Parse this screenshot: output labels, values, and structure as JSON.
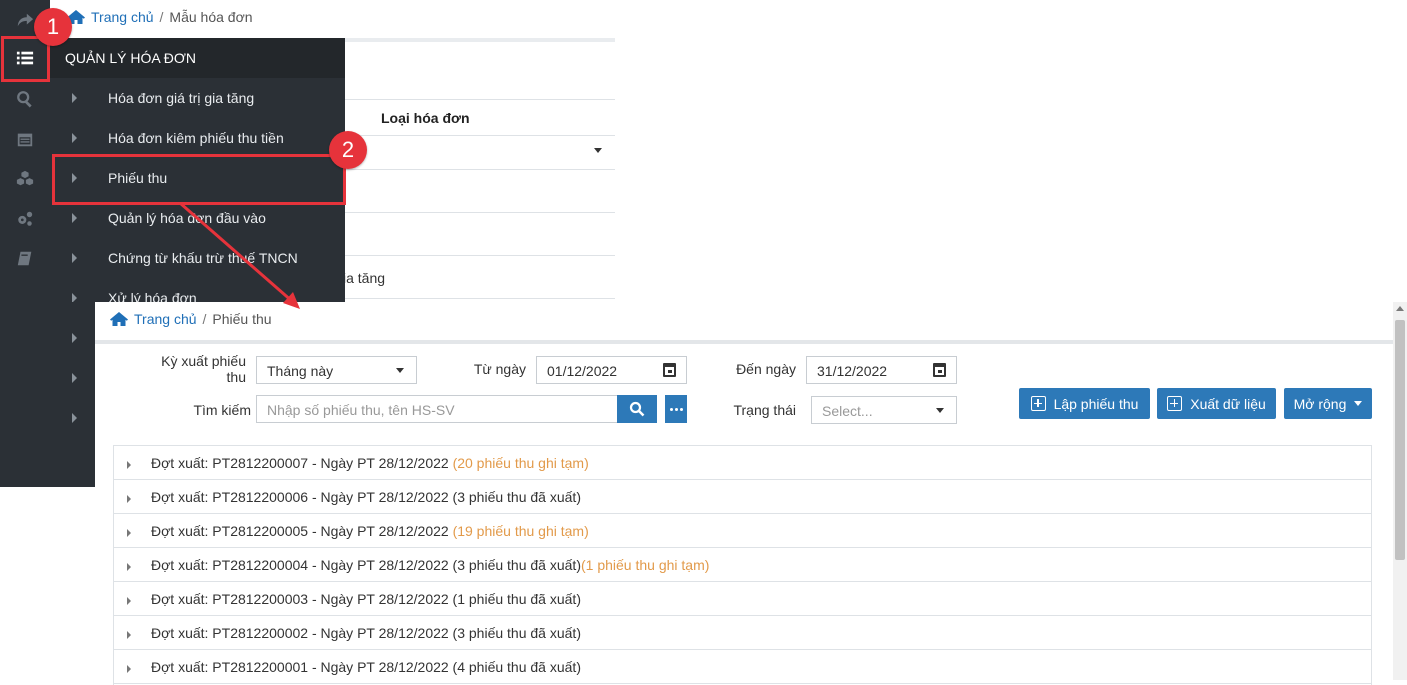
{
  "back_page": {
    "breadcrumb": {
      "home": "Trang chủ",
      "separator": "/",
      "current": "Mẫu hóa đơn"
    },
    "column_header": "Loại hóa đơn",
    "row_text": "ia tăng"
  },
  "menu": {
    "header": "QUẢN LÝ HÓA ĐƠN",
    "items": [
      "Hóa đơn giá trị gia tăng",
      "Hóa đơn kiêm phiếu thu tiền",
      "Phiếu thu",
      "Quản lý hóa đơn đầu vào",
      "Chứng từ khấu trừ thuế TNCN",
      "Xử lý hóa đơn"
    ]
  },
  "rail_icons": [
    "share-icon",
    "list-icon",
    "search-icon",
    "calendar-icon",
    "cubes-icon",
    "cogs-icon",
    "book-icon"
  ],
  "page": {
    "breadcrumb": {
      "home": "Trang chủ",
      "separator": "/",
      "current": "Phiếu thu"
    },
    "filters": {
      "period_label_line1": "Kỳ xuất phiếu",
      "period_label_line2": "thu",
      "period_value": "Tháng này",
      "from_label": "Từ ngày",
      "from_value": "01/12/2022",
      "to_label": "Đến ngày",
      "to_value": "31/12/2022",
      "search_label": "Tìm kiếm",
      "search_placeholder": "Nhập số phiếu thu, tên HS-SV",
      "status_label": "Trạng thái",
      "status_placeholder": "Select..."
    },
    "buttons": {
      "create": "Lập phiếu thu",
      "export": "Xuất dữ liệu",
      "more": "Mở rộng"
    },
    "batches": [
      {
        "text": "Đợt xuất: PT2812200007 - Ngày PT 28/12/2022 ",
        "note": "(20 phiếu thu ghi tạm)"
      },
      {
        "text": "Đợt xuất: PT2812200006 - Ngày PT 28/12/2022 (3 phiếu thu đã xuất)",
        "note": ""
      },
      {
        "text": "Đợt xuất: PT2812200005 - Ngày PT 28/12/2022 ",
        "note": "(19 phiếu thu ghi tạm)"
      },
      {
        "text": "Đợt xuất: PT2812200004 - Ngày PT 28/12/2022 (3 phiếu thu đã xuất)",
        "note": "(1 phiếu thu ghi tạm)"
      },
      {
        "text": "Đợt xuất: PT2812200003 - Ngày PT 28/12/2022 (1 phiếu thu đã xuất)",
        "note": ""
      },
      {
        "text": "Đợt xuất: PT2812200002 - Ngày PT 28/12/2022 (3 phiếu thu đã xuất)",
        "note": ""
      },
      {
        "text": "Đợt xuất: PT2812200001 - Ngày PT 28/12/2022 (4 phiếu thu đã xuất)",
        "note": ""
      }
    ]
  },
  "annotations": {
    "step1": "1",
    "step2": "2"
  },
  "colors": {
    "accent": "#2d79b8",
    "sidebar": "#2b3036",
    "warning_text": "#e29a4a",
    "annotation": "#e6333b"
  }
}
